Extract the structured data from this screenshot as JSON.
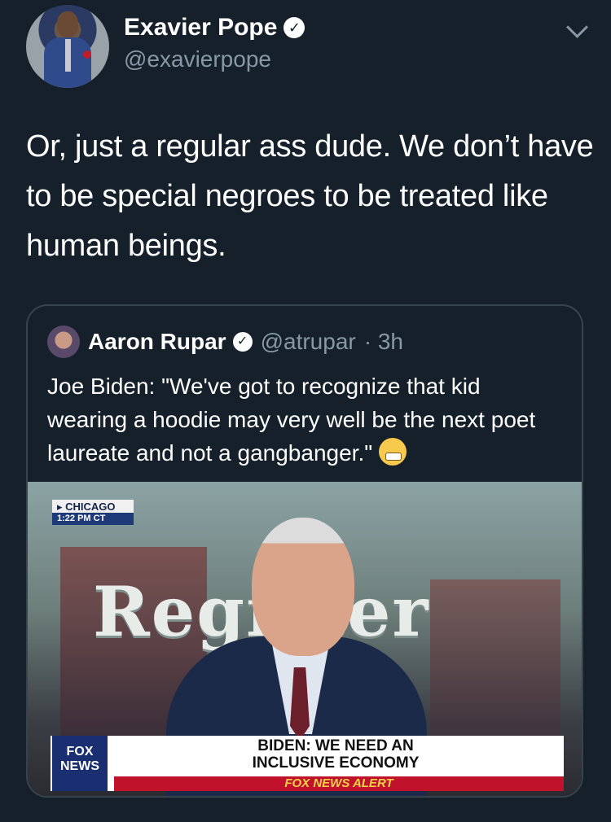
{
  "author": {
    "display_name": "Exavier Pope",
    "handle": "@exavierpope"
  },
  "tweet": {
    "text": "Or, just a regular ass dude. We don’t have to be special negroes to be treated like human beings."
  },
  "quoted_tweet": {
    "display_name": "Aaron Rupar",
    "handle": "@atrupar",
    "time": "· 3h",
    "text": "Joe Biden: \"We've got to recognize that kid wearing a hoodie may very well be the next poet laureate and not a gangbanger.\"",
    "emoji": "grimacing-face"
  },
  "media": {
    "location_bug": "CHICAGO",
    "location_time": "1:22 PM CT",
    "background_text": "Register",
    "network_logo_top": "FOX",
    "network_logo_bottom": "NEWS",
    "headline_line1": "BIDEN: WE NEED AN",
    "headline_line2": "INCLUSIVE ECONOMY",
    "alert_label": "FOX NEWS ALERT"
  },
  "colors": {
    "background": "#15202b",
    "secondary_text": "#8899a6",
    "border": "#38444d",
    "fox_red": "#c0122a",
    "fox_blue": "#1a2f72"
  }
}
